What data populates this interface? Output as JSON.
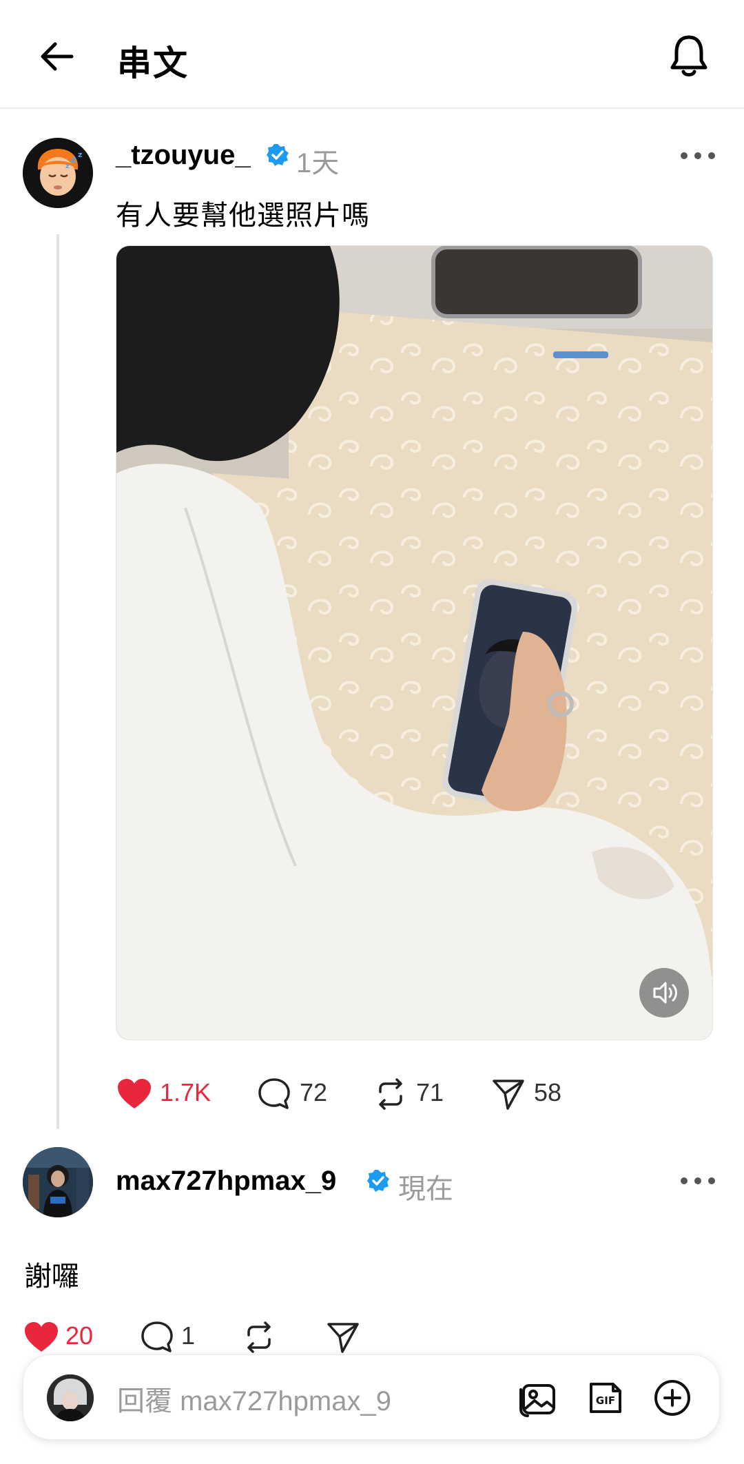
{
  "header": {
    "title": "串文"
  },
  "post": {
    "username": "_tzouyue_",
    "time": "1天",
    "text": "有人要幫他選照片嗎",
    "likes": "1.7K",
    "comments": "72",
    "reposts": "71",
    "shares": "58",
    "liked": true
  },
  "reply": {
    "username": "max727hpmax_9",
    "time": "現在",
    "text": "謝囉",
    "likes": "20",
    "comments": "1",
    "liked": true
  },
  "composer": {
    "placeholder": "回覆 max727hpmax_9"
  },
  "colors": {
    "like": "#e8273d",
    "verified": "#1d9bf0",
    "muted": "#9a9a9a"
  }
}
